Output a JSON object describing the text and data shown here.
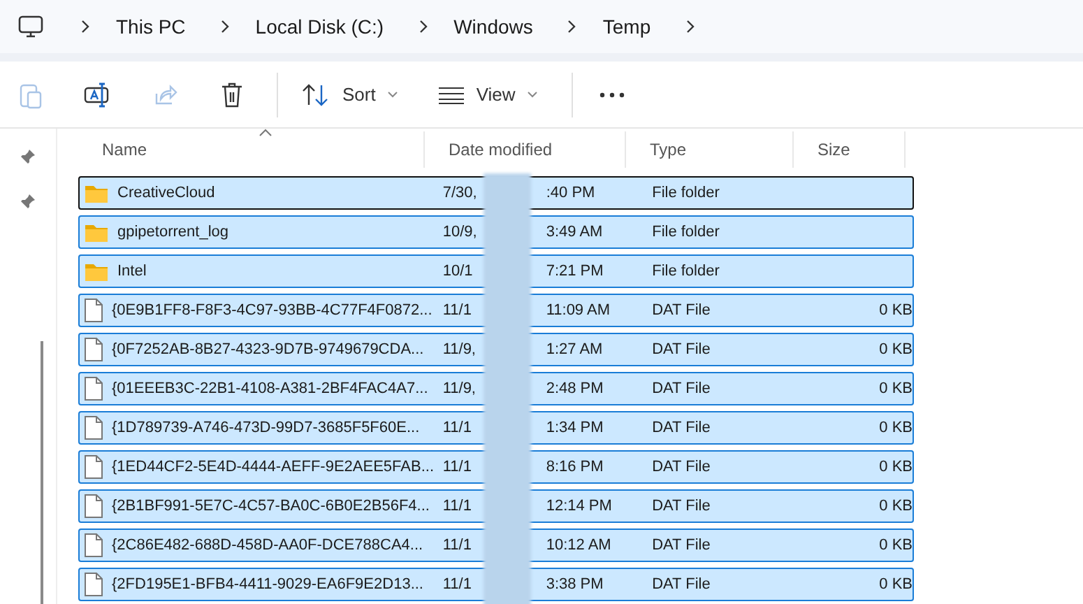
{
  "breadcrumb": [
    "This PC",
    "Local Disk (C:)",
    "Windows",
    "Temp"
  ],
  "toolbar": [
    {
      "kind": "paste",
      "disabled": true
    },
    {
      "kind": "rename",
      "disabled": false
    },
    {
      "kind": "share",
      "disabled": true
    },
    {
      "kind": "delete",
      "disabled": false
    },
    {
      "kind": "sort",
      "label": "Sort",
      "disabled": false
    },
    {
      "kind": "view",
      "label": "View",
      "disabled": false
    },
    {
      "kind": "more",
      "disabled": false
    }
  ],
  "columns": [
    "Name",
    "Date modified",
    "Type",
    "Size"
  ],
  "rows": [
    {
      "kind": "folder",
      "name": "CreativeCloud",
      "date_left": "7/30,",
      "date_right": ":40 PM",
      "type": "File folder",
      "selected": true,
      "focused": true
    },
    {
      "kind": "folder",
      "name": "gpipetorrent_log",
      "date_left": "10/9,",
      "date_right": "3:49 AM",
      "type": "File folder",
      "selected": true,
      "focused": false
    },
    {
      "kind": "folder",
      "name": "Intel",
      "date_left": "10/1",
      "date_right": "7:21 PM",
      "type": "File folder",
      "selected": true,
      "focused": false
    },
    {
      "kind": "file",
      "name": "{0E9B1FF8-F8F3-4C97-93BB-4C77F4F0872...",
      "date_left": "11/1",
      "date_right": "11:09 AM",
      "type": "DAT File",
      "size": "0 KB",
      "selected": true,
      "focused": false
    },
    {
      "kind": "file",
      "name": "{0F7252AB-8B27-4323-9D7B-9749679CDA...",
      "date_left": "11/9,",
      "date_right": "1:27 AM",
      "type": "DAT File",
      "size": "0 KB",
      "selected": true,
      "focused": false
    },
    {
      "kind": "file",
      "name": "{01EEEB3C-22B1-4108-A381-2BF4FAC4A7...",
      "date_left": "11/9,",
      "date_right": "2:48 PM",
      "type": "DAT File",
      "size": "0 KB",
      "selected": true,
      "focused": false
    },
    {
      "kind": "file",
      "name": "{1D789739-A746-473D-99D7-3685F5F60E...",
      "date_left": "11/1",
      "date_right": "1:34 PM",
      "type": "DAT File",
      "size": "0 KB",
      "selected": true,
      "focused": false
    },
    {
      "kind": "file",
      "name": "{1ED44CF2-5E4D-4444-AEFF-9E2AEE5FAB...",
      "date_left": "11/1",
      "date_right": "8:16 PM",
      "type": "DAT File",
      "size": "0 KB",
      "selected": true,
      "focused": false
    },
    {
      "kind": "file",
      "name": "{2B1BF991-5E7C-4C57-BA0C-6B0E2B56F4...",
      "date_left": "11/1",
      "date_right": "12:14 PM",
      "type": "DAT File",
      "size": "0 KB",
      "selected": true,
      "focused": false
    },
    {
      "kind": "file",
      "name": "{2C86E482-688D-458D-AA0F-DCE788CA4...",
      "date_left": "11/1",
      "date_right": "10:12 AM",
      "type": "DAT File",
      "size": "0 KB",
      "selected": true,
      "focused": false
    },
    {
      "kind": "file",
      "name": "{2FD195E1-BFB4-4411-9029-EA6F9E2D13...",
      "date_left": "11/1",
      "date_right": "3:38 PM",
      "type": "DAT File",
      "size": "0 KB",
      "selected": true,
      "focused": false
    }
  ]
}
